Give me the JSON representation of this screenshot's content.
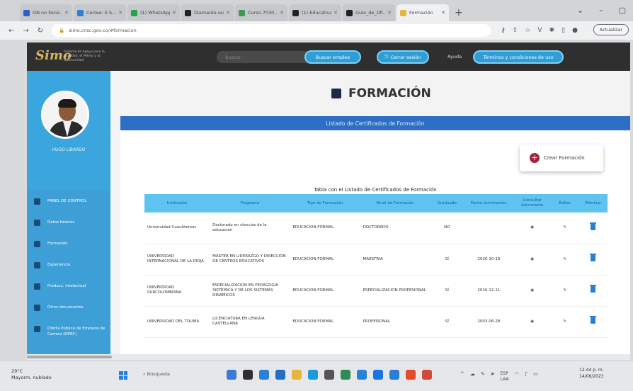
{
  "browser": {
    "tabs": [
      {
        "label": "ON no llenó...",
        "color": "#2a5fd0",
        "active": false
      },
      {
        "label": "Correo: E.S...",
        "color": "#2a7fd4",
        "active": false
      },
      {
        "label": "(1) WhatsApp",
        "color": "#25a244",
        "active": false
      },
      {
        "label": "Diamante ou...",
        "color": "#222222",
        "active": false
      },
      {
        "label": "Curso 7030...",
        "color": "#3a9a52",
        "active": false
      },
      {
        "label": "(1) Educativa",
        "color": "#222222",
        "active": false
      },
      {
        "label": "Guía_de_Ofi...",
        "color": "#222222",
        "active": false
      },
      {
        "label": "Formación",
        "color": "#e8b43a",
        "active": true
      }
    ],
    "new_tab": "+",
    "url": "simo.cnsc.gov.co/#formacion",
    "update_label": "Actualizar"
  },
  "header": {
    "logo": "Simo",
    "logo_text": "Sistema de Apoyo para la Igualdad, el Mérito y la Oportunidad",
    "search_placeholder": "Buscar",
    "buttons": {
      "search_jobs": "Buscar empleo",
      "logout": "Cerrar sesión",
      "terms": "Términos y condiciones de uso"
    },
    "help_link": "Ayuda"
  },
  "sidebar": {
    "user_name": "HUGO LIBARDO",
    "items": [
      {
        "label": "PANEL DE CONTROL"
      },
      {
        "label": "Datos básicos"
      },
      {
        "label": "Formación"
      },
      {
        "label": "Experiencia"
      },
      {
        "label": "Producc. intelectual"
      },
      {
        "label": "Otros documentos"
      },
      {
        "label": "Oferta Pública de Empleos de Carrera (OPEC)"
      }
    ]
  },
  "main": {
    "title": "FORMACIÓN",
    "band_title": "Listado de Certificados de Formación",
    "create_label": "Crear Formación",
    "table_caption": "Tabla con el Listado de Certificados de Formación",
    "columns": [
      "Institución",
      "Programa",
      "Tipo de Formación",
      "Nivel de Formación",
      "Graduado",
      "Fecha terminación",
      "Consultar documento",
      "Editar",
      "Eliminar"
    ],
    "rows": [
      {
        "institucion": "Universidad Cuauhtemoc",
        "programa": "Doctorado en ciencias de la educación",
        "tipo": "EDUCACION FORMAL",
        "nivel": "DOCTORADO",
        "graduado": "NO",
        "fecha": ""
      },
      {
        "institucion": "UNIVERSIDAD INTERNACIONAL DE LA RIOJA",
        "programa": "MÁSTER EN LIDERAZGO Y DIRECCIÓN DE CENTROS EDUCATIVOS",
        "tipo": "EDUCACION FORMAL",
        "nivel": "MAESTRIA",
        "graduado": "SÍ",
        "fecha": "2020-10-19"
      },
      {
        "institucion": "UNIVERSIDAD SURCOLOMBIANA",
        "programa": "ESPECIALIZACION EN PEDAGOGIA SISTEMICA Y DE LOS SISTEMAS DINAMICOS",
        "tipo": "EDUCACION FORMAL",
        "nivel": "ESPECIALIZACION PROFESIONAL",
        "graduado": "SÍ",
        "fecha": "2010-12-11"
      },
      {
        "institucion": "UNIVERSIDAD DEL TOLIMA",
        "programa": "LICENCIATURA EN LENGUA CASTELLANA",
        "tipo": "EDUCACION FORMAL",
        "nivel": "PROFESIONAL",
        "graduado": "SÍ",
        "fecha": "2003-06-28"
      }
    ]
  },
  "taskbar": {
    "weather_temp": "29°C",
    "weather_desc": "Mayorm. nublado",
    "search_label": "Búsqueda",
    "lang": "ESP",
    "lang2": "LAA",
    "time": "12:44 p. m.",
    "date": "14/06/2023",
    "app_colors": [
      "#3a7bd5",
      "#2f2f2f",
      "#2a82d8",
      "#1f6fc5",
      "#e8b43a",
      "#1a9bd7",
      "#555555",
      "#2e8b57",
      "#2a82d8",
      "#1a73e8",
      "#2a7fd4",
      "#e34c26",
      "#d04a3a"
    ]
  }
}
